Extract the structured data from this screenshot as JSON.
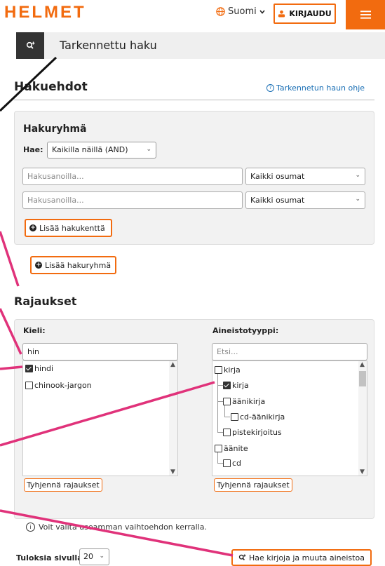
{
  "header": {
    "logo": "HELMET",
    "language": "Suomi",
    "login_label": "KIRJAUDU",
    "colors": {
      "accent": "#f26b0f",
      "link": "#1a6fb5"
    }
  },
  "advanced": {
    "title": "Tarkennettu haku",
    "icon": "search-plus-icon"
  },
  "conditions": {
    "heading": "Hakuehdot",
    "help_link": "Tarkennetun haun ohje",
    "group": {
      "title": "Hakuryhmä",
      "operator_label": "Hae:",
      "operator_value": "Kaikilla näillä (AND)",
      "rows": [
        {
          "placeholder": "Hakusanoilla...",
          "field": "Kaikki osumat"
        },
        {
          "placeholder": "Hakusanoilla...",
          "field": "Kaikki osumat"
        }
      ],
      "add_field": "Lisää hakukenttä"
    },
    "add_group": "Lisää hakuryhmä"
  },
  "limits": {
    "heading": "Rajaukset",
    "language": {
      "label": "Kieli:",
      "search_value": "hin",
      "options": [
        {
          "label": "hindi",
          "checked": true
        },
        {
          "label": "chinook-jargon",
          "checked": false
        }
      ],
      "clear": "Tyhjennä rajaukset"
    },
    "format": {
      "label": "Aineistotyyppi:",
      "placeholder": "Etsi...",
      "options": [
        {
          "label": "kirja",
          "checked": false,
          "level": 0
        },
        {
          "label": "kirja",
          "checked": true,
          "level": 1
        },
        {
          "label": "äänikirja",
          "checked": false,
          "level": 1
        },
        {
          "label": "cd-äänikirja",
          "checked": false,
          "level": 2
        },
        {
          "label": "pistekirjoitus",
          "checked": false,
          "level": 1
        },
        {
          "label": "äänite",
          "checked": false,
          "level": 0
        },
        {
          "label": "cd",
          "checked": false,
          "level": 1
        }
      ],
      "clear": "Tyhjennä rajaukset"
    },
    "info": "Voit valita useamman vaihtoehdon kerralla."
  },
  "footer": {
    "per_page_label": "Tuloksia sivulla",
    "per_page_value": "20",
    "search_button": "Hae kirjoja ja muuta aineistoa"
  },
  "annotations": {
    "black_line_color": "#111111",
    "pink_line_color": "#e0327a"
  }
}
